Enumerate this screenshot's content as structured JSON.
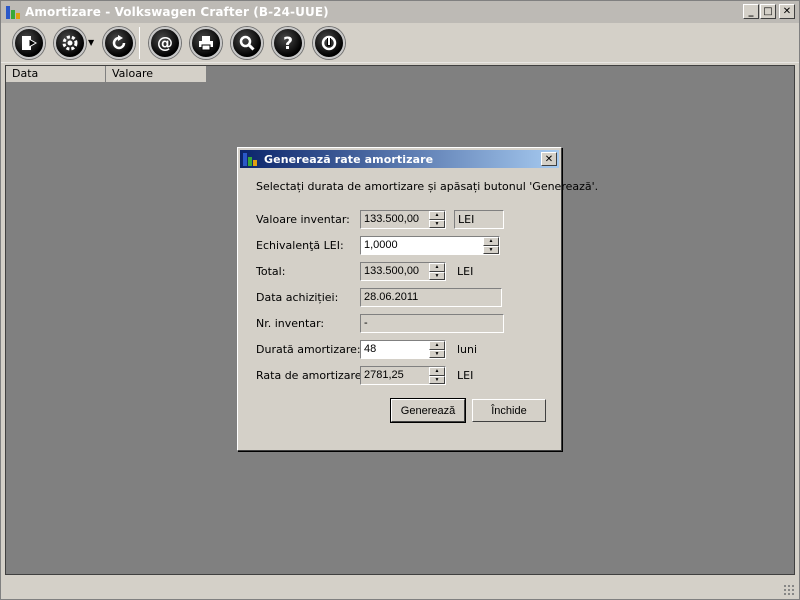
{
  "window": {
    "title": "Amortizare - Volkswagen Crafter (B-24-UUE)",
    "min": "_",
    "max": "□",
    "close": "✕"
  },
  "toolbar": {
    "icons": [
      "exit-icon",
      "gear-icon",
      "refresh-icon",
      "at-icon",
      "print-icon",
      "search-icon",
      "help-icon",
      "power-icon"
    ]
  },
  "grid": {
    "columns": [
      "Data",
      "Valoare"
    ]
  },
  "dialog": {
    "title": "Generează rate amortizare",
    "close": "✕",
    "instruction": "Selectați durata de amortizare și apăsați butonul 'Generează'.",
    "fields": {
      "valoare_inventar": {
        "label": "Valoare inventar:",
        "value": "133.500,00",
        "unit": "LEI"
      },
      "echivalenta": {
        "label": "Echivalenţă LEI:",
        "value": "1,0000"
      },
      "total": {
        "label": "Total:",
        "value": "133.500,00",
        "unit": "LEI"
      },
      "data_achizitiei": {
        "label": "Data achiziției:",
        "value": "28.06.2011"
      },
      "nr_inventar": {
        "label": "Nr. inventar:",
        "value": "-"
      },
      "durata": {
        "label": "Durată amortizare:",
        "value": "48",
        "unit": "luni"
      },
      "rata": {
        "label": "Rata de amortizare:",
        "value": "2781,25",
        "unit": "LEI"
      }
    },
    "buttons": {
      "generate": "Generează",
      "close": "Închide"
    }
  }
}
